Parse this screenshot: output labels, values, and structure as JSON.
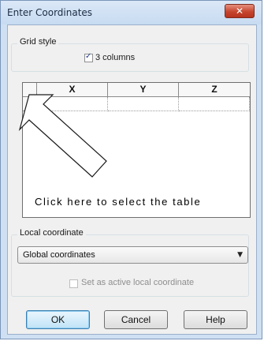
{
  "window": {
    "title": "Enter Coordinates",
    "close_label": "✕"
  },
  "grid_style": {
    "label": "Grid style",
    "three_columns_label": "3 columns",
    "three_columns_checked": true
  },
  "table": {
    "columns": [
      "X",
      "Y",
      "Z"
    ],
    "rows": [
      [
        "",
        "",
        ""
      ]
    ]
  },
  "hint_text": "Click here to select the table",
  "local_coordinate": {
    "label": "Local coordinate",
    "selected": "Global coordinates",
    "active_label": "Set as active local coordinate",
    "active_checked": false,
    "active_enabled": false
  },
  "buttons": {
    "ok": "OK",
    "cancel": "Cancel",
    "help": "Help"
  }
}
